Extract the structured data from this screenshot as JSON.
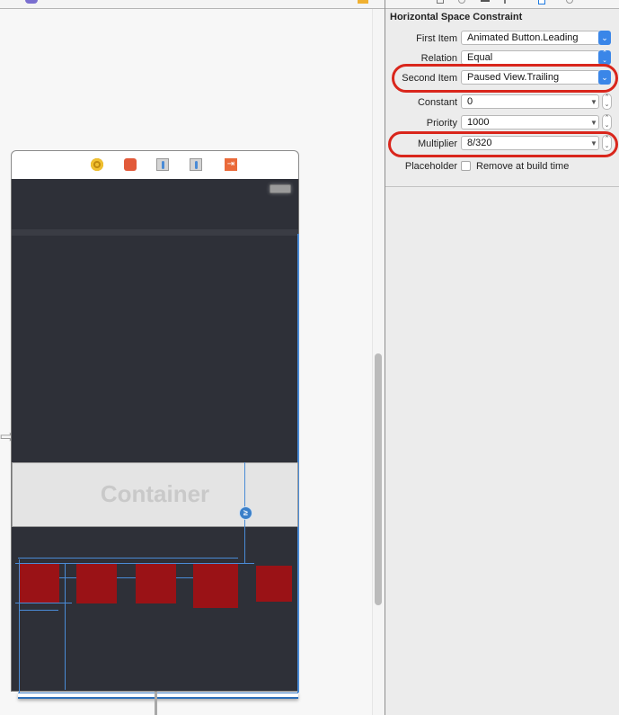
{
  "inspector": {
    "section_title": "Horizontal Space Constraint",
    "rows": {
      "first_item": {
        "label": "First Item",
        "value": "Animated Button.Leading"
      },
      "relation": {
        "label": "Relation",
        "value": "Equal"
      },
      "second_item": {
        "label": "Second Item",
        "value": "Paused View.Trailing"
      },
      "constant": {
        "label": "Constant",
        "value": "0"
      },
      "priority": {
        "label": "Priority",
        "value": "1000"
      },
      "multiplier": {
        "label": "Multiplier",
        "value": "8/320"
      },
      "placeholder": {
        "label": "Placeholder",
        "checkbox_label": "Remove at build time",
        "checked": false
      }
    },
    "highlighted_rows": [
      "Second Item",
      "Multiplier"
    ],
    "highlight_color": "#d9261c",
    "accent_color": "#3a86e8"
  },
  "canvas": {
    "scene_dock_icons": [
      "view-controller-icon",
      "first-responder-icon",
      "outlet-key-icon",
      "outlet-key-icon",
      "exit-icon"
    ],
    "container_label": "Container",
    "constraint_badge": "≥",
    "constraint_color": "#4a8bd6",
    "button_color": "#9a1216",
    "background_color": "#2e3038"
  }
}
